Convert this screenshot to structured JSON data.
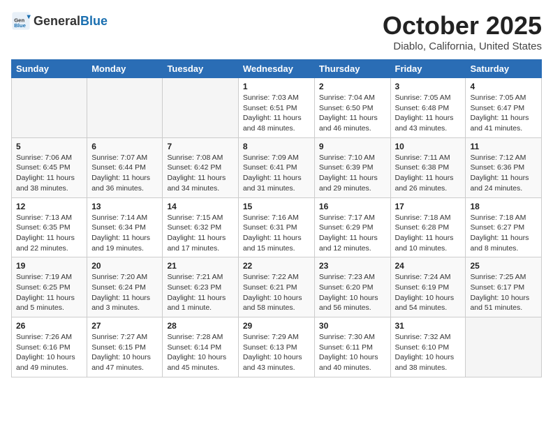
{
  "header": {
    "logo_general": "General",
    "logo_blue": "Blue",
    "month": "October 2025",
    "location": "Diablo, California, United States"
  },
  "weekdays": [
    "Sunday",
    "Monday",
    "Tuesday",
    "Wednesday",
    "Thursday",
    "Friday",
    "Saturday"
  ],
  "weeks": [
    [
      {
        "day": "",
        "info": ""
      },
      {
        "day": "",
        "info": ""
      },
      {
        "day": "",
        "info": ""
      },
      {
        "day": "1",
        "info": "Sunrise: 7:03 AM\nSunset: 6:51 PM\nDaylight: 11 hours\nand 48 minutes."
      },
      {
        "day": "2",
        "info": "Sunrise: 7:04 AM\nSunset: 6:50 PM\nDaylight: 11 hours\nand 46 minutes."
      },
      {
        "day": "3",
        "info": "Sunrise: 7:05 AM\nSunset: 6:48 PM\nDaylight: 11 hours\nand 43 minutes."
      },
      {
        "day": "4",
        "info": "Sunrise: 7:05 AM\nSunset: 6:47 PM\nDaylight: 11 hours\nand 41 minutes."
      }
    ],
    [
      {
        "day": "5",
        "info": "Sunrise: 7:06 AM\nSunset: 6:45 PM\nDaylight: 11 hours\nand 38 minutes."
      },
      {
        "day": "6",
        "info": "Sunrise: 7:07 AM\nSunset: 6:44 PM\nDaylight: 11 hours\nand 36 minutes."
      },
      {
        "day": "7",
        "info": "Sunrise: 7:08 AM\nSunset: 6:42 PM\nDaylight: 11 hours\nand 34 minutes."
      },
      {
        "day": "8",
        "info": "Sunrise: 7:09 AM\nSunset: 6:41 PM\nDaylight: 11 hours\nand 31 minutes."
      },
      {
        "day": "9",
        "info": "Sunrise: 7:10 AM\nSunset: 6:39 PM\nDaylight: 11 hours\nand 29 minutes."
      },
      {
        "day": "10",
        "info": "Sunrise: 7:11 AM\nSunset: 6:38 PM\nDaylight: 11 hours\nand 26 minutes."
      },
      {
        "day": "11",
        "info": "Sunrise: 7:12 AM\nSunset: 6:36 PM\nDaylight: 11 hours\nand 24 minutes."
      }
    ],
    [
      {
        "day": "12",
        "info": "Sunrise: 7:13 AM\nSunset: 6:35 PM\nDaylight: 11 hours\nand 22 minutes."
      },
      {
        "day": "13",
        "info": "Sunrise: 7:14 AM\nSunset: 6:34 PM\nDaylight: 11 hours\nand 19 minutes."
      },
      {
        "day": "14",
        "info": "Sunrise: 7:15 AM\nSunset: 6:32 PM\nDaylight: 11 hours\nand 17 minutes."
      },
      {
        "day": "15",
        "info": "Sunrise: 7:16 AM\nSunset: 6:31 PM\nDaylight: 11 hours\nand 15 minutes."
      },
      {
        "day": "16",
        "info": "Sunrise: 7:17 AM\nSunset: 6:29 PM\nDaylight: 11 hours\nand 12 minutes."
      },
      {
        "day": "17",
        "info": "Sunrise: 7:18 AM\nSunset: 6:28 PM\nDaylight: 11 hours\nand 10 minutes."
      },
      {
        "day": "18",
        "info": "Sunrise: 7:18 AM\nSunset: 6:27 PM\nDaylight: 11 hours\nand 8 minutes."
      }
    ],
    [
      {
        "day": "19",
        "info": "Sunrise: 7:19 AM\nSunset: 6:25 PM\nDaylight: 11 hours\nand 5 minutes."
      },
      {
        "day": "20",
        "info": "Sunrise: 7:20 AM\nSunset: 6:24 PM\nDaylight: 11 hours\nand 3 minutes."
      },
      {
        "day": "21",
        "info": "Sunrise: 7:21 AM\nSunset: 6:23 PM\nDaylight: 11 hours\nand 1 minute."
      },
      {
        "day": "22",
        "info": "Sunrise: 7:22 AM\nSunset: 6:21 PM\nDaylight: 10 hours\nand 58 minutes."
      },
      {
        "day": "23",
        "info": "Sunrise: 7:23 AM\nSunset: 6:20 PM\nDaylight: 10 hours\nand 56 minutes."
      },
      {
        "day": "24",
        "info": "Sunrise: 7:24 AM\nSunset: 6:19 PM\nDaylight: 10 hours\nand 54 minutes."
      },
      {
        "day": "25",
        "info": "Sunrise: 7:25 AM\nSunset: 6:17 PM\nDaylight: 10 hours\nand 51 minutes."
      }
    ],
    [
      {
        "day": "26",
        "info": "Sunrise: 7:26 AM\nSunset: 6:16 PM\nDaylight: 10 hours\nand 49 minutes."
      },
      {
        "day": "27",
        "info": "Sunrise: 7:27 AM\nSunset: 6:15 PM\nDaylight: 10 hours\nand 47 minutes."
      },
      {
        "day": "28",
        "info": "Sunrise: 7:28 AM\nSunset: 6:14 PM\nDaylight: 10 hours\nand 45 minutes."
      },
      {
        "day": "29",
        "info": "Sunrise: 7:29 AM\nSunset: 6:13 PM\nDaylight: 10 hours\nand 43 minutes."
      },
      {
        "day": "30",
        "info": "Sunrise: 7:30 AM\nSunset: 6:11 PM\nDaylight: 10 hours\nand 40 minutes."
      },
      {
        "day": "31",
        "info": "Sunrise: 7:32 AM\nSunset: 6:10 PM\nDaylight: 10 hours\nand 38 minutes."
      },
      {
        "day": "",
        "info": ""
      }
    ]
  ]
}
